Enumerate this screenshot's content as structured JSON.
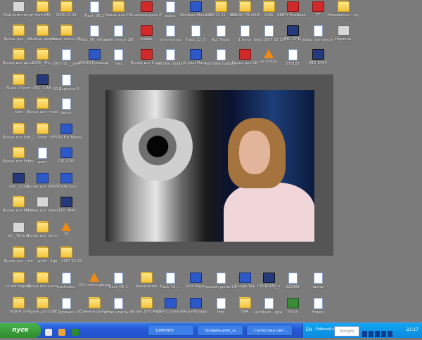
{
  "desktop_icons": [
    {
      "label": "Мой компьютер",
      "kind": "gray"
    },
    {
      "label": "Ярлык для _rich",
      "kind": "folder"
    },
    {
      "label": "Ярлык для диссертация",
      "kind": "folder"
    },
    {
      "label": "Music 2 Send",
      "kind": "folder"
    },
    {
      "label": "best",
      "kind": "folder"
    },
    {
      "label": "Ярлык для kids_2005",
      "kind": "folder"
    },
    {
      "label": "Ярлык для Рабочий ст...",
      "kind": "folder"
    },
    {
      "label": "DSC_1219",
      "kind": "media"
    },
    {
      "label": "Ярлык для My Music",
      "kind": "folder"
    },
    {
      "label": "art__Tatiana",
      "kind": "gray"
    },
    {
      "label": "Ярлык для _rich",
      "kind": "folder"
    },
    {
      "label": "sound forge60",
      "kind": "folder"
    },
    {
      "label": "NOKIA CP",
      "kind": "folder"
    },
    {
      "label": "from MM",
      "kind": "folder"
    },
    {
      "label": "Festival people",
      "kind": "folder"
    },
    {
      "label": "2005__My...",
      "kind": "folder"
    },
    {
      "label": "DSC_1258",
      "kind": "media"
    },
    {
      "label": "Ярлык для _music",
      "kind": "folder"
    },
    {
      "label": "Show",
      "kind": "folder"
    },
    {
      "label": "sport",
      "kind": "doc"
    },
    {
      "label": "Ярлык для SERVER",
      "kind": "blue"
    },
    {
      "label": "Ярлык для пленкой",
      "kind": "gray"
    },
    {
      "label": "Ярлык для ratsvidos2",
      "kind": "folder"
    },
    {
      "label": "print",
      "kind": "folder"
    },
    {
      "label": "Ярлык для экспорт",
      "kind": "folder"
    },
    {
      "label": "Ярлык для 2007",
      "kind": "folder"
    },
    {
      "label": "2006 12 04",
      "kind": "folder"
    },
    {
      "label": "Новая папка (2)",
      "kind": "folder"
    },
    {
      "label": "2007 02 __ рек",
      "kind": "doc"
    },
    {
      "label": "06 Дорожка 6",
      "kind": "doc"
    },
    {
      "label": "dance",
      "kind": "doc"
    },
    {
      "label": "EPSON File Manager",
      "kind": "blue"
    },
    {
      "label": "GIP 2005",
      "kind": "blue"
    },
    {
      "label": "EPSON Scan",
      "kind": "blue"
    },
    {
      "label": "2005 0644",
      "kind": "media"
    },
    {
      "label": "25",
      "kind": "orange"
    },
    {
      "label": "1gb _ 2007 02 19",
      "kind": "folder"
    },
    {
      "label": "medvedev",
      "kind": "doc"
    },
    {
      "label": "13 Дорожка 13",
      "kind": "doc"
    },
    {
      "label": "Track_08_1",
      "kind": "doc"
    },
    {
      "label": "Track_06_ ofigennoe_k",
      "kind": "doc"
    },
    {
      "label": "EPSON Руководст...",
      "kind": "blue"
    },
    {
      "label": "VLC media player",
      "kind": "orange"
    },
    {
      "label": "Ермеевы разное",
      "kind": "folder"
    },
    {
      "label": "Ярлык для CD",
      "kind": "folder"
    },
    {
      "label": "nashe nemoe 2005",
      "kind": "doc"
    },
    {
      "label": "naiu",
      "kind": "doc"
    },
    {
      "label": "Track_08_1",
      "kind": "doc"
    },
    {
      "label": "farmer anatha sting",
      "kind": "doc"
    },
    {
      "label": "Съемный диск (F)",
      "kind": "red"
    },
    {
      "label": "mobile",
      "kind": "red"
    },
    {
      "label": "Ярлык для Съемны...",
      "kind": "red"
    },
    {
      "label": "Alexandkers",
      "kind": "folder"
    },
    {
      "label": "Копия 177CANON",
      "kind": "folder"
    },
    {
      "label": "active",
      "kind": "doc"
    },
    {
      "label": "sony-nexrus",
      "kind": "doc"
    },
    {
      "label": "vsd dilan bobbin",
      "kind": "doc"
    },
    {
      "label": "Track_19_...",
      "kind": "doc"
    },
    {
      "label": "DivX Converter",
      "kind": "blue"
    },
    {
      "label": "Windows Movie Maker",
      "kind": "blue"
    },
    {
      "label": "Track_22_3",
      "kind": "doc"
    },
    {
      "label": "Crystal Player",
      "kind": "blue"
    },
    {
      "label": "DivX Player",
      "kind": "blue"
    },
    {
      "label": "RiverManager",
      "kind": "blue"
    },
    {
      "label": "2006 02 25 _ 512",
      "kind": "folder"
    },
    {
      "label": "ALL Tracks",
      "kind": "doc"
    },
    {
      "label": "vsd dilan babbin4",
      "kind": "doc"
    },
    {
      "label": "spanish guitar 2007 02 16",
      "kind": "doc"
    },
    {
      "label": "http",
      "kind": "doc"
    },
    {
      "label": "BOKDAY ТВ 2006",
      "kind": "folder"
    },
    {
      "label": "1 temp",
      "kind": "doc"
    },
    {
      "label": "Ярлык для СИ",
      "kind": "red"
    },
    {
      "label": "Google Talk",
      "kind": "blue"
    },
    {
      "label": "EKA",
      "kind": "folder"
    },
    {
      "label": "2006",
      "kind": "folder"
    },
    {
      "label": "temp 2007 03 15",
      "kind": "doc"
    },
    {
      "label": "vlc-0.8.6a",
      "kind": "orange"
    },
    {
      "label": "DSCN0659_s",
      "kind": "media"
    },
    {
      "label": "autoback - ерж",
      "kind": "doc"
    },
    {
      "label": "ABBYY FineRead...",
      "kind": "red"
    },
    {
      "label": "IMG_9741",
      "kind": "media"
    },
    {
      "label": "575128",
      "kind": "doc"
    },
    {
      "label": "222083",
      "kind": "doc"
    },
    {
      "label": "Skype",
      "kind": "green"
    },
    {
      "label": "TT",
      "kind": "red"
    },
    {
      "label": "zakaz non-dancing",
      "kind": "doc"
    },
    {
      "label": "IMG_8454",
      "kind": "media"
    },
    {
      "label": "tantra",
      "kind": "doc"
    },
    {
      "label": "Новое",
      "kind": "doc"
    },
    {
      "label": "Неизвестно... музыки",
      "kind": "folder"
    },
    {
      "label": "Корзина",
      "kind": "gray"
    }
  ],
  "taskbar": {
    "start_label": "пуск",
    "tasks": [
      {
        "label": "100PENTX"
      },
      {
        "label": "Профиль print_sc..."
      },
      {
        "label": "статистика сайт..."
      }
    ],
    "tray": {
      "language": "EN",
      "desktop_label": "Рабочий стол",
      "search_placeholder": "Google",
      "clock": "22:17"
    }
  }
}
